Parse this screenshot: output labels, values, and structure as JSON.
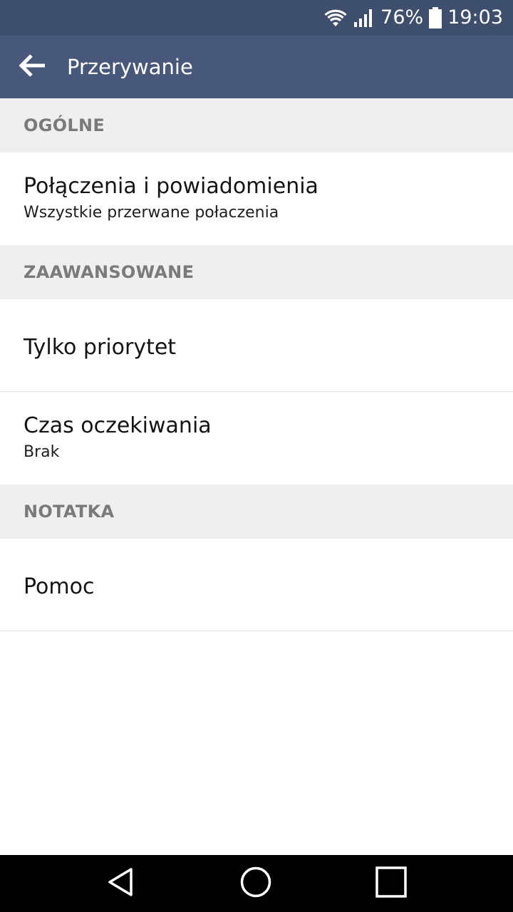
{
  "status_bar": {
    "battery": "76%",
    "time": "19:03",
    "icons": [
      "wifi-icon",
      "signal-icon",
      "battery-icon"
    ]
  },
  "app_bar": {
    "title": "Przerywanie",
    "back_icon": "arrow-left-icon"
  },
  "sections": [
    {
      "header": "OGÓLNE",
      "items": [
        {
          "title": "Połączenia i powiadomienia",
          "subtitle": "Wszystkie przerwane połaczenia"
        }
      ]
    },
    {
      "header": "ZAAWANSOWANE",
      "items": [
        {
          "title": "Tylko priorytet"
        },
        {
          "title": "Czas oczekiwania",
          "subtitle": "Brak"
        }
      ]
    },
    {
      "header": "NOTATKA",
      "items": [
        {
          "title": "Pomoc"
        }
      ]
    }
  ],
  "nav_bar": {
    "icons": [
      "back-triangle-icon",
      "home-circle-icon",
      "recents-square-icon"
    ]
  },
  "colors": {
    "status_bar": "#3e4f6e",
    "app_bar": "#47587a",
    "section_bg": "#efefef",
    "section_text": "#7a7a7a"
  }
}
